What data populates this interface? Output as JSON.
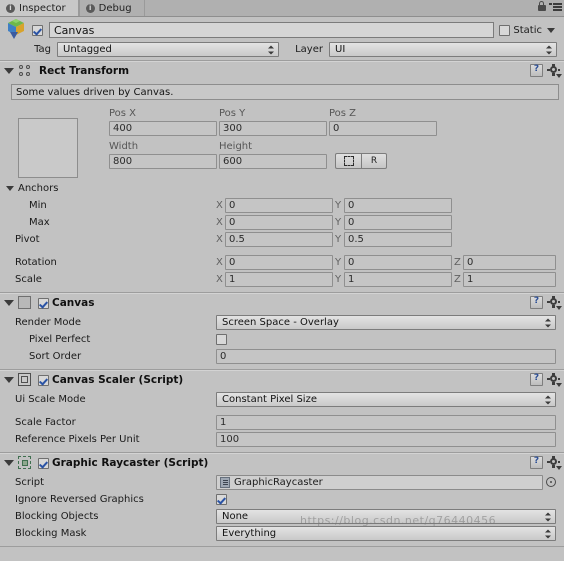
{
  "window": {
    "tabs": [
      {
        "label": "Inspector",
        "icon": "info-icon",
        "active": true
      },
      {
        "label": "Debug",
        "icon": "info-icon",
        "active": false
      }
    ],
    "lock_icon": "lock-icon",
    "menu_icon": "hamburger-menu-icon"
  },
  "object_header": {
    "gameobject_icon": "gameobject-cube-icon",
    "enabled": true,
    "name": "Canvas",
    "static_label": "Static",
    "static_checked": false,
    "tag_label": "Tag",
    "tag_value": "Untagged",
    "layer_label": "Layer",
    "layer_value": "UI"
  },
  "components": [
    {
      "id": "rect-transform",
      "title": "Rect Transform",
      "icon": "rect-transform-icon",
      "has_enable_checkbox": false,
      "expanded": true,
      "help_text": "Some values driven by Canvas.",
      "pos_headers": [
        "Pos X",
        "Pos Y",
        "Pos Z"
      ],
      "pos_values": [
        "400",
        "300",
        "0"
      ],
      "size_headers": [
        "Width",
        "Height"
      ],
      "size_values": [
        "800",
        "600"
      ],
      "anchor_preset_icon": "anchor-preset-icon",
      "blueprint_button": "R",
      "anchors_label": "Anchors",
      "anchor_rows": [
        {
          "label": "Min",
          "x_label": "X",
          "x": "0",
          "y_label": "Y",
          "y": "0"
        },
        {
          "label": "Max",
          "x_label": "X",
          "x": "0",
          "y_label": "Y",
          "y": "0"
        }
      ],
      "pivot": {
        "label": "Pivot",
        "x_label": "X",
        "x": "0.5",
        "y_label": "Y",
        "y": "0.5"
      },
      "rotation": {
        "label": "Rotation",
        "x_label": "X",
        "x": "0",
        "y_label": "Y",
        "y": "0",
        "z_label": "Z",
        "z": "0"
      },
      "scale": {
        "label": "Scale",
        "x_label": "X",
        "x": "1",
        "y_label": "Y",
        "y": "1",
        "z_label": "Z",
        "z": "1"
      }
    },
    {
      "id": "canvas",
      "title": "Canvas",
      "icon": "canvas-icon",
      "enabled": true,
      "fields": [
        {
          "label": "Render Mode",
          "type": "popup",
          "value": "Screen Space - Overlay",
          "indent": 0
        },
        {
          "label": "Pixel Perfect",
          "type": "checkbox",
          "value": false,
          "indent": 1
        },
        {
          "label": "Sort Order",
          "type": "text",
          "value": "0",
          "indent": 1
        }
      ]
    },
    {
      "id": "canvas-scaler",
      "title": "Canvas Scaler (Script)",
      "icon": "canvas-scaler-icon",
      "enabled": true,
      "fields": [
        {
          "label": "Ui Scale Mode",
          "type": "popup",
          "value": "Constant Pixel Size",
          "indent": 0
        },
        {
          "label": "Scale Factor",
          "type": "text",
          "value": "1",
          "indent": 0
        },
        {
          "label": "Reference Pixels Per Unit",
          "type": "text",
          "value": "100",
          "indent": 0
        }
      ]
    },
    {
      "id": "graphic-raycaster",
      "title": "Graphic Raycaster (Script)",
      "icon": "graphic-raycaster-icon",
      "enabled": true,
      "fields": [
        {
          "label": "Script",
          "type": "object",
          "value": "GraphicRaycaster",
          "indent": 0
        },
        {
          "label": "Ignore Reversed Graphics",
          "type": "checkbox",
          "value": true,
          "indent": 0
        },
        {
          "label": "Blocking Objects",
          "type": "popup",
          "value": "None",
          "indent": 0
        },
        {
          "label": "Blocking Mask",
          "type": "popup",
          "value": "Everything",
          "indent": 0
        }
      ]
    }
  ],
  "watermark": "https://blog.csdn.net/q76440456",
  "colors": {
    "panel_bg": "#c2c2c2",
    "field_bg": "#c5c5c5",
    "check_blue": "#2a53a5",
    "label_dim": "#565656"
  }
}
